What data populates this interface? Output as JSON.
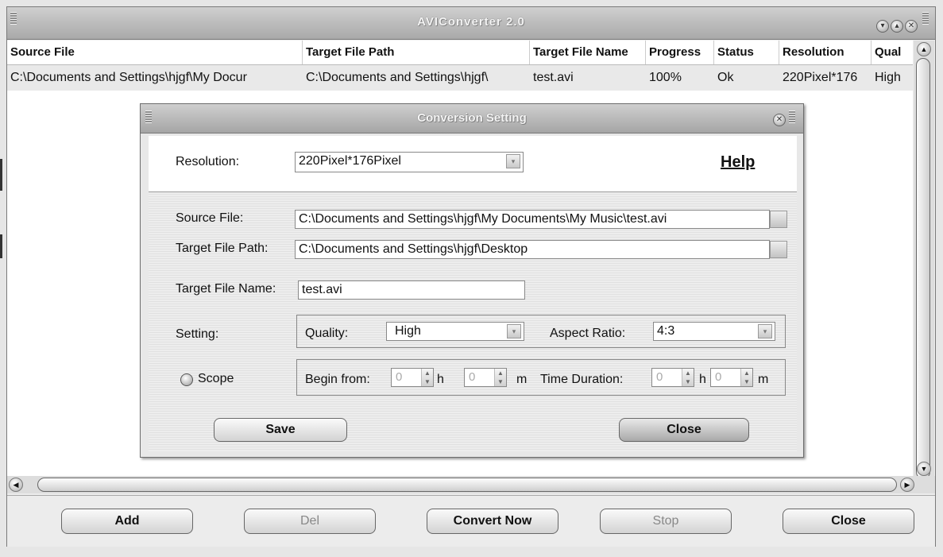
{
  "window": {
    "title": "AVIConverter 2.0"
  },
  "table": {
    "headers": [
      "Source File",
      "Target File Path",
      "Target File Name",
      "Progress",
      "Status",
      "Resolution",
      "Qual"
    ],
    "rows": [
      [
        "C:\\Documents and Settings\\hjgf\\My Docur",
        "C:\\Documents and Settings\\hjgf\\",
        "test.avi",
        "100%",
        "Ok",
        "220Pixel*176",
        "High"
      ]
    ]
  },
  "bottom": {
    "add": "Add",
    "del": "Del",
    "convert": "Convert Now",
    "stop": "Stop",
    "close": "Close"
  },
  "dialog": {
    "title": "Conversion Setting",
    "resolution_label": "Resolution:",
    "resolution_value": "220Pixel*176Pixel",
    "help": "Help",
    "source_label": "Source File:",
    "source_value": "C:\\Documents and Settings\\hjgf\\My Documents\\My Music\\test.avi",
    "target_path_label": "Target File Path:",
    "target_path_value": "C:\\Documents and Settings\\hjgf\\Desktop",
    "target_name_label": "Target File Name:",
    "target_name_value": "test.avi",
    "setting_label": "Setting:",
    "quality_label": "Quality:",
    "quality_value": "High",
    "aspect_label": "Aspect Ratio:",
    "aspect_value": "4:3",
    "scope_label": "Scope",
    "begin_label": "Begin from:",
    "begin_h": "0",
    "h_unit": "h",
    "begin_m": "0",
    "m_unit": "m",
    "duration_label": "Time Duration:",
    "dur_h": "0",
    "dur_m": "0",
    "save": "Save",
    "close": "Close"
  }
}
